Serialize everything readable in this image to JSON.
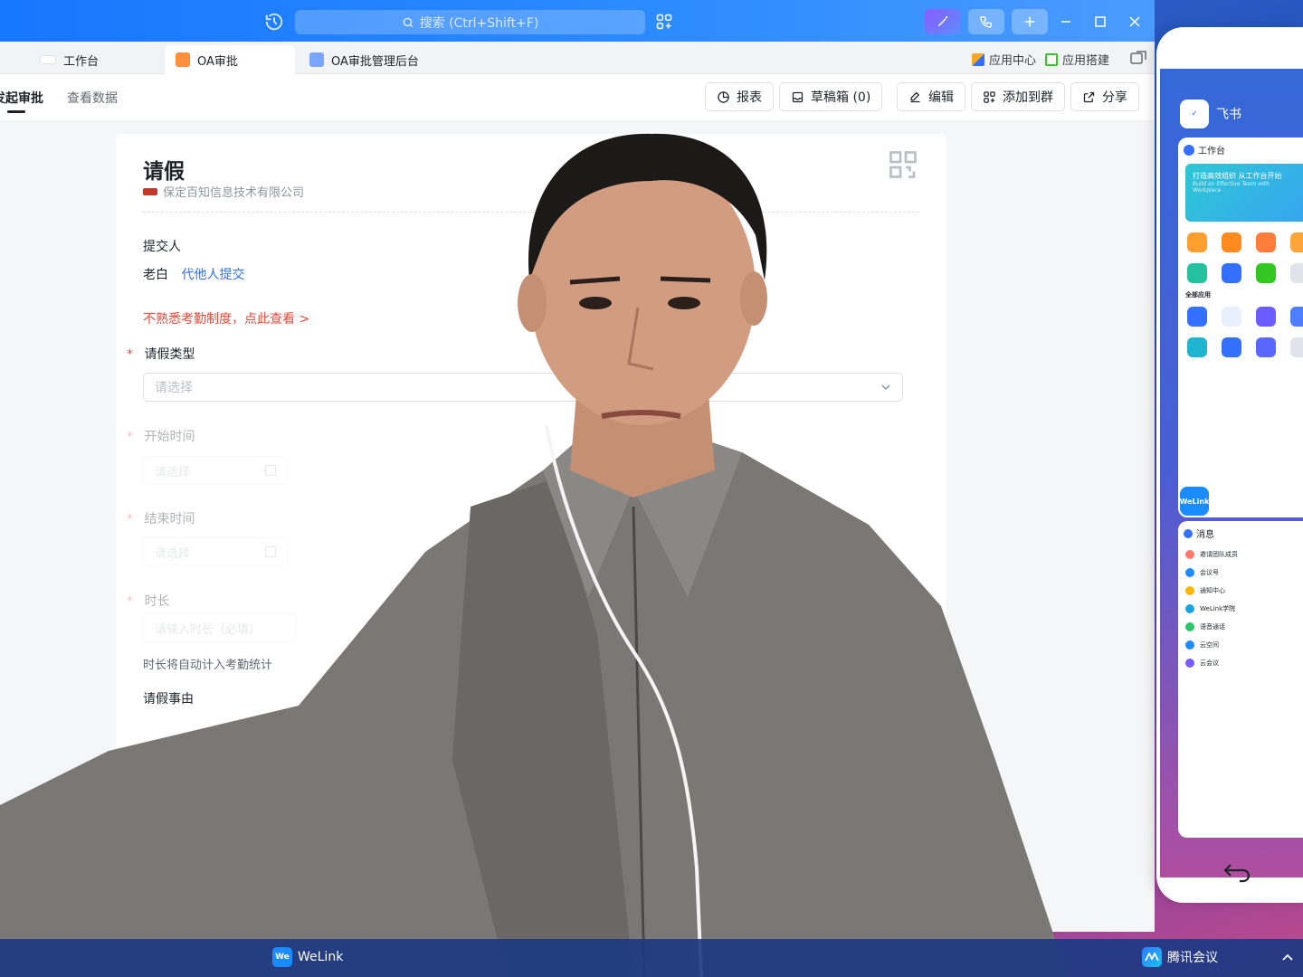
{
  "titlebar": {
    "search_placeholder": "搜索 (Ctrl+Shift+F)"
  },
  "tabs": [
    {
      "label": "工作台"
    },
    {
      "label": "OA审批"
    },
    {
      "label": "OA审批管理后台"
    }
  ],
  "tab_actions": {
    "app_center": "应用中心",
    "app_builder": "应用搭建"
  },
  "toolbar": {
    "nav_initiate": "发起审批",
    "nav_data": "查看数据",
    "report": "报表",
    "drafts": "草稿箱 (0)",
    "edit": "编辑",
    "add_to_group": "添加到群",
    "share": "分享"
  },
  "form": {
    "title": "请假",
    "company": "保定百知信息技术有限公司",
    "submitter_label": "提交人",
    "submitter_name": "老白",
    "proxy_submit": "代他人提交",
    "attendance_hint": "不熟悉考勤制度，点此查看 >",
    "leave_type_label": "请假类型",
    "leave_type_placeholder": "请选择",
    "start_time_label": "开始时间",
    "start_time_placeholder": "请选择",
    "end_time_label": "结束时间",
    "end_time_placeholder": "请选择",
    "duration_label": "时长",
    "duration_placeholder": "请输入时长（必填）",
    "duration_note": "时长将自动计入考勤统计",
    "reason_label": "请假事由"
  },
  "side_panel": {
    "feishu_name": "飞书",
    "feishu_preview_title": "工作台",
    "feishu_banner": "打造高效组织 从工作台开始",
    "feishu_banner_sub": "Build an Effective Team with Workplace",
    "feishu_all_apps": "全部应用",
    "welink_name": "WeLink",
    "welink_preview_title": "消息",
    "welink_items": [
      "邀请团队成员",
      "会议号",
      "通知中心",
      "WeLink学院",
      "语音通话",
      "云空间",
      "云会议"
    ]
  },
  "taskbar": {
    "welink_label": "WeLink",
    "welink_icon_text": "We",
    "tencent_meeting_label": "腾讯会议"
  },
  "colors": {
    "brand_blue": "#1677ff",
    "link_blue": "#3370ff",
    "required_red": "#f54a45",
    "hint_red": "#e84a3c"
  }
}
